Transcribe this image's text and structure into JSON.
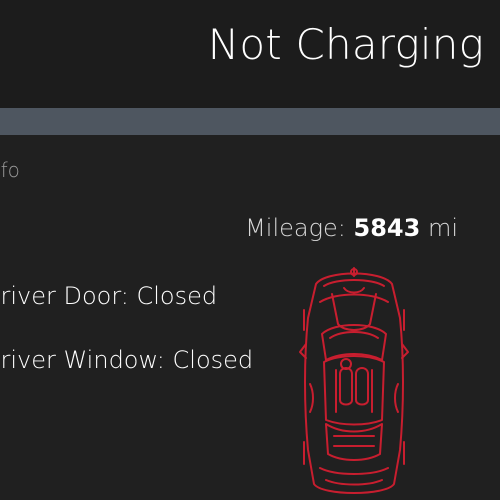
{
  "status": {
    "charging_text": "Not Charging"
  },
  "section": {
    "label": "Info"
  },
  "mileage": {
    "label": "Mileage:",
    "value": "5843",
    "unit": "mi"
  },
  "vehicle": {
    "door_text": "Driver Door: Closed",
    "window_text": "Driver Window: Closed",
    "outline_color": "#c81e2f",
    "icon": "car-top-view-icon"
  },
  "colors": {
    "background": "#202020",
    "divider": "#4e5660",
    "accent": "#c81e2f"
  }
}
